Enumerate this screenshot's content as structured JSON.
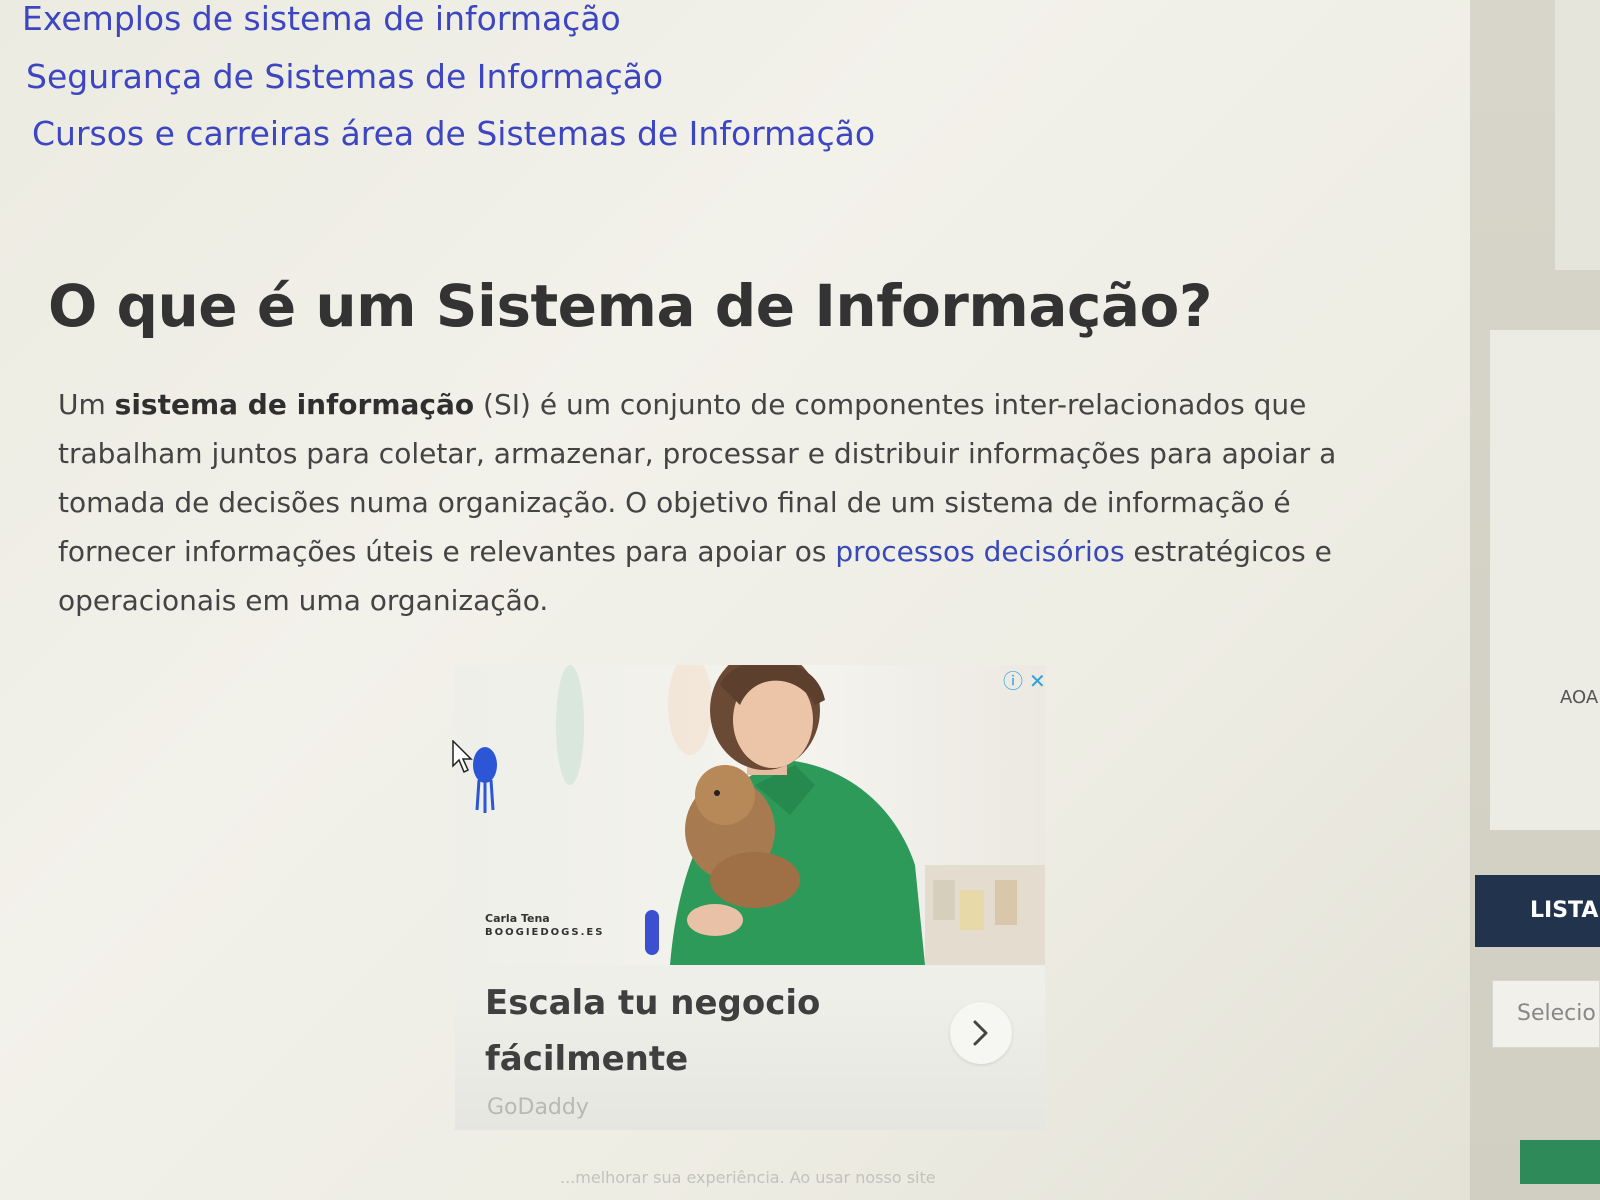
{
  "related_links": [
    "Exemplos de sistema de informação",
    "Segurança de Sistemas de Informação",
    "Cursos e carreiras área de Sistemas de Informação"
  ],
  "article": {
    "heading": "O que é um Sistema de Informação?",
    "p_prefix": "Um ",
    "p_bold": "sistema de informação",
    "p_mid": " (SI) é um conjunto de componentes inter-relacionados que trabalham juntos para coletar, armazenar, processar e distribuir informações para apoiar a tomada de decisões numa organização. O objetivo final de um sistema de informação é fornecer informações úteis e relevantes para apoiar os ",
    "p_link": "processos decisórios",
    "p_suffix": " estratégicos e operacionais em uma organização."
  },
  "ad": {
    "info_icon": "ⓘ",
    "close_icon": "✕",
    "brand_name": "Carla Tena",
    "brand_site": "BOOGIEDOGS.ES",
    "headline": "Escala tu negocio fácilmente",
    "advertiser": "GoDaddy",
    "arrow_icon": "chevron-right-icon"
  },
  "sidebar": {
    "label": "AOA",
    "list_title": "LISTA",
    "select_placeholder": "Selecio"
  },
  "cookie_notice": "...melhorar sua experiência. Ao usar nosso site",
  "colors": {
    "link": "#3d46c2",
    "sidebar_dark": "#22344d",
    "accent_green": "#2f8a5a"
  }
}
